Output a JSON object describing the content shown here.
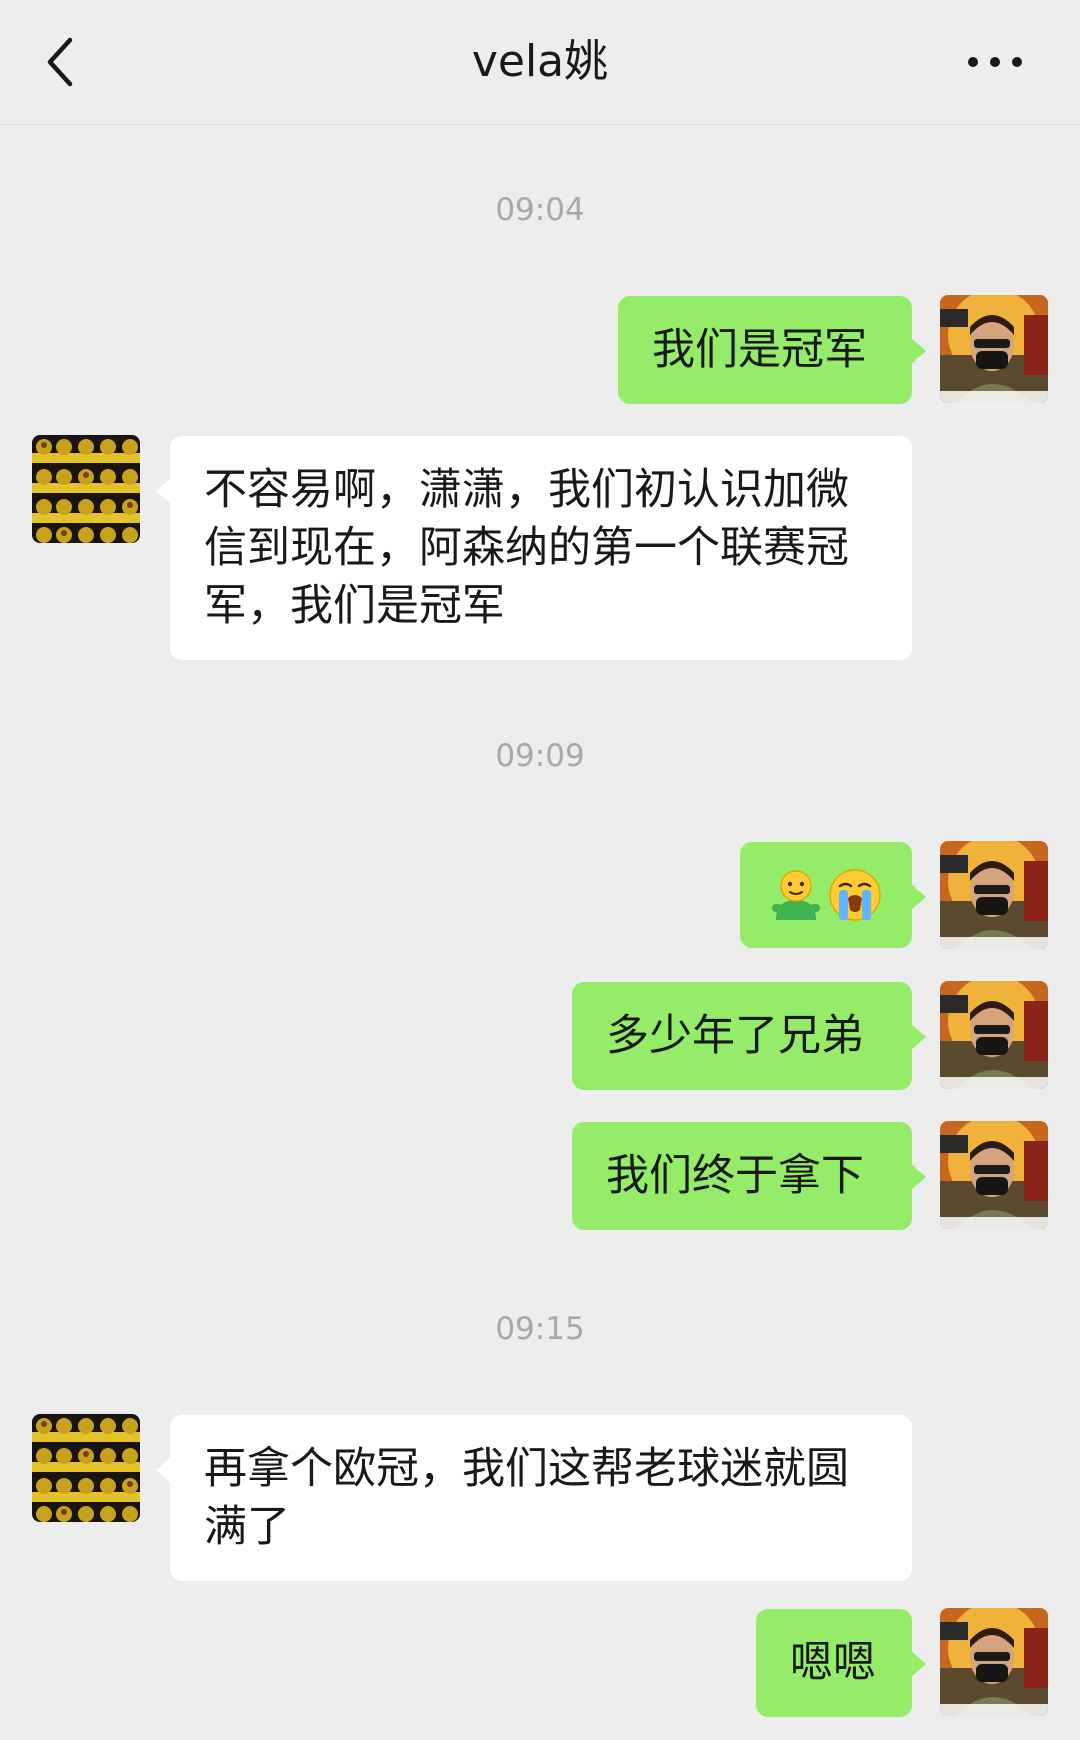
{
  "header": {
    "title": "vela姚",
    "back_icon": "chevron-left-icon",
    "more_icon": "ellipsis-icon"
  },
  "colors": {
    "background": "#ededed",
    "my_bubble": "#95ec69",
    "other_bubble": "#ffffff",
    "timestamp": "#a8a8a8"
  },
  "chat": {
    "timestamps": [
      "09:04",
      "09:09",
      "09:15"
    ],
    "messages": [
      {
        "from": "me",
        "text": "我们是冠军"
      },
      {
        "from": "other",
        "text": "不容易啊，潇潇，我们初认识加微信到现在，阿森纳的第一个联赛冠军，我们是冠军"
      },
      {
        "from": "me",
        "emojis": [
          "person-emoji",
          "loudly-crying-face-emoji"
        ]
      },
      {
        "from": "me",
        "text": "多少年了兄弟"
      },
      {
        "from": "me",
        "text": "我们终于拿下"
      },
      {
        "from": "other",
        "text": "再拿个欧冠，我们这帮老球迷就圆满了"
      },
      {
        "from": "me",
        "text": "嗯嗯"
      }
    ]
  }
}
